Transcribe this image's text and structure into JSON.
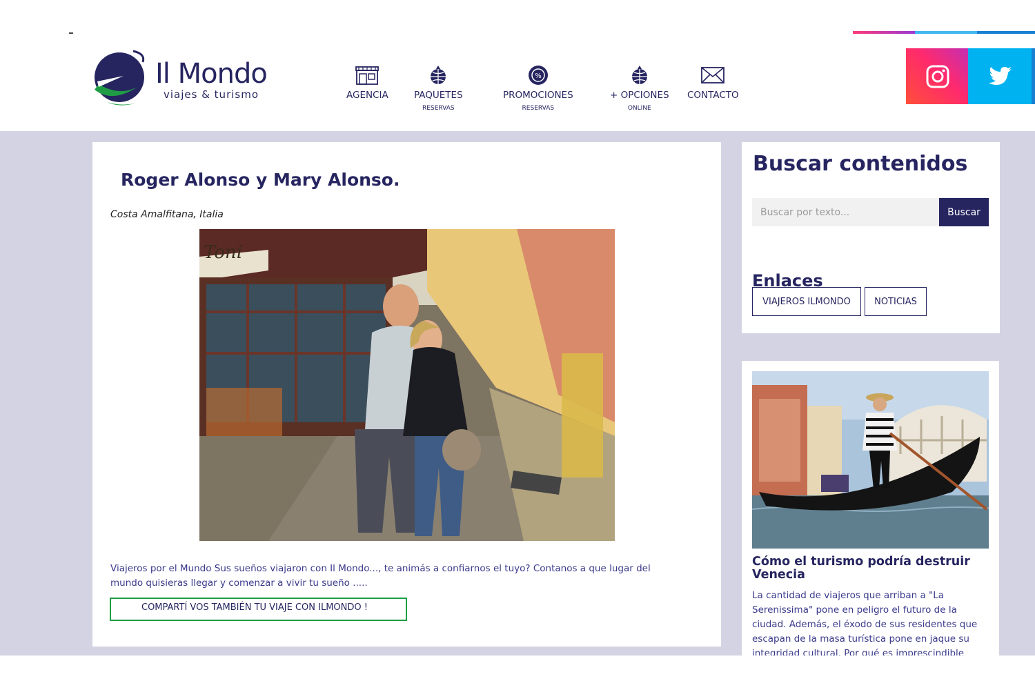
{
  "brand": {
    "name": "Il Mondo",
    "tagline": "viajes & turismo",
    "colors": {
      "primary": "#262560",
      "accent_green": "#1f9d45",
      "instagram": "#ff2a6d",
      "twitter": "#00b2f0"
    }
  },
  "nav": [
    {
      "label": "AGENCIA",
      "sub": "",
      "icon": "storefront-icon"
    },
    {
      "label": "PAQUETES",
      "sub": "RESERVAS",
      "icon": "globe-pin-icon"
    },
    {
      "label": "PROMOCIONES",
      "sub": "RESERVAS",
      "icon": "percent-badge-icon"
    },
    {
      "label": "+ OPCIONES",
      "sub": "ONLINE",
      "icon": "globe-pin-icon"
    },
    {
      "label": "CONTACTO",
      "sub": "",
      "icon": "envelope-icon"
    }
  ],
  "social": [
    {
      "name": "instagram-icon"
    },
    {
      "name": "twitter-icon"
    }
  ],
  "post": {
    "title": "Roger Alonso y Mary Alonso.",
    "location": "Costa Amalfitana, Italia",
    "photo_sign": "Toni",
    "text": "Viajeros por el Mundo Sus sueños viajaron con Il Mondo..., te animás a confiarnos el tuyo? Contanos a que lugar del mundo quisieras llegar y comenzar a vivir tu sueño .....",
    "share_label": "COMPARTÍ VOS TAMBIÉN TU VIAJE CON ILMONDO !"
  },
  "sidebar": {
    "search_title": "Buscar contenidos",
    "search_placeholder": "Buscar por texto...",
    "search_button": "Buscar",
    "links_title": "Enlaces",
    "links": [
      "VIAJEROS ILMONDO",
      "NOTICIAS"
    ],
    "article": {
      "title": "Cómo el turismo podría destruir Venecia",
      "text": "La cantidad de viajeros que arriban a \"La Serenissima\" pone en peligro el futuro de la ciudad. Además, el éxodo de sus residentes que escapan de la masa turística pone en jaque su integridad cultural. Por qué es imprescindible"
    }
  }
}
